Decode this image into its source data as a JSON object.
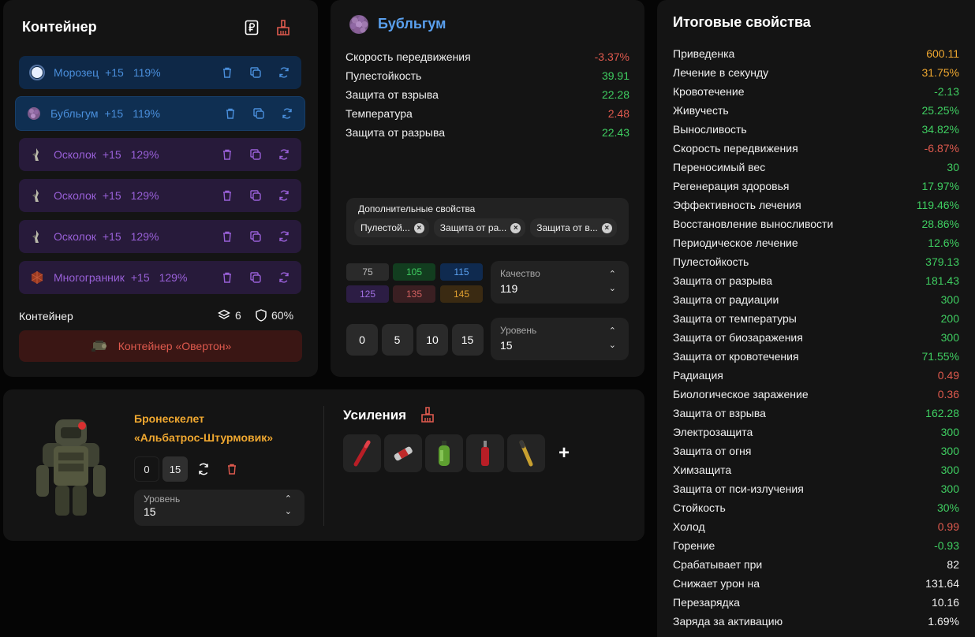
{
  "container": {
    "title": "Контейнер",
    "artifacts": [
      {
        "name": "Морозец",
        "level": "+15",
        "percent": "119%",
        "color": "blue",
        "icon": "snowflake-orb-icon"
      },
      {
        "name": "Бубльгум",
        "level": "+15",
        "percent": "119%",
        "color": "blue",
        "icon": "bubblegum-icon",
        "selected": true
      },
      {
        "name": "Осколок",
        "level": "+15",
        "percent": "129%",
        "color": "purple",
        "icon": "shard-icon"
      },
      {
        "name": "Осколок",
        "level": "+15",
        "percent": "129%",
        "color": "purple",
        "icon": "shard-icon"
      },
      {
        "name": "Осколок",
        "level": "+15",
        "percent": "129%",
        "color": "purple",
        "icon": "shard-icon"
      },
      {
        "name": "Многогранник",
        "level": "+15",
        "percent": "129%",
        "color": "purple",
        "icon": "polyhedron-icon"
      }
    ],
    "footer_label": "Контейнер",
    "slots": "6",
    "protection": "60%",
    "container_name": "Контейнер «Овертон»"
  },
  "artifact": {
    "name": "Бубльгум",
    "stats": [
      {
        "label": "Скорость передвижения",
        "value": "-3.37%",
        "tone": "neg"
      },
      {
        "label": "Пулестойкость",
        "value": "39.91",
        "tone": "pos"
      },
      {
        "label": "Защита от взрыва",
        "value": "22.28",
        "tone": "pos"
      },
      {
        "label": "Температура",
        "value": "2.48",
        "tone": "neg"
      },
      {
        "label": "Защита от разрыва",
        "value": "22.43",
        "tone": "pos"
      }
    ],
    "extra_title": "Дополнительные свойства",
    "extra_chips": [
      "Пулестой...",
      "Защита от ра...",
      "Защита от в..."
    ],
    "quality_buttons": [
      {
        "label": "75",
        "bg": "#2a2a2a",
        "fg": "#bdbdbd"
      },
      {
        "label": "105",
        "bg": "#123d1f",
        "fg": "#3fce61"
      },
      {
        "label": "115",
        "bg": "#0f2a4f",
        "fg": "#5aa0ee"
      },
      {
        "label": "125",
        "bg": "#2c1d44",
        "fg": "#a070e0"
      },
      {
        "label": "135",
        "bg": "#3a1f22",
        "fg": "#d06060"
      },
      {
        "label": "145",
        "bg": "#3a2a12",
        "fg": "#e0a030"
      }
    ],
    "quality_label": "Качество",
    "quality_value": "119",
    "level_buttons": [
      "0",
      "5",
      "10",
      "15"
    ],
    "level_label": "Уровень",
    "level_value": "15"
  },
  "armor": {
    "name_line1": "Бронескелет",
    "name_line2": "«Альбатрос-Штурмовик»",
    "level_buttons": [
      "0",
      "15"
    ],
    "level_label": "Уровень",
    "level_value": "15",
    "boosts_title": "Усиления",
    "boosts": [
      "red-stick-icon",
      "syringe-icon",
      "green-bottle-icon",
      "red-bottle-icon",
      "yellow-stick-icon"
    ],
    "add_label": "+"
  },
  "summary": {
    "title": "Итоговые свойства",
    "rows": [
      {
        "label": "Приведенка",
        "value": "600.11",
        "tone": "gold"
      },
      {
        "label": "Лечение в секунду",
        "value": "31.75%",
        "tone": "gold"
      },
      {
        "label": "Кровотечение",
        "value": "-2.13",
        "tone": "pos"
      },
      {
        "label": "Живучесть",
        "value": "25.25%",
        "tone": "pos"
      },
      {
        "label": "Выносливость",
        "value": "34.82%",
        "tone": "pos"
      },
      {
        "label": "Скорость передвижения",
        "value": "-6.87%",
        "tone": "neg"
      },
      {
        "label": "Переносимый вес",
        "value": "30",
        "tone": "pos"
      },
      {
        "label": "Регенерация здоровья",
        "value": "17.97%",
        "tone": "pos"
      },
      {
        "label": "Эффективность лечения",
        "value": "119.46%",
        "tone": "pos"
      },
      {
        "label": "Восстановление выносливости",
        "value": "28.86%",
        "tone": "pos"
      },
      {
        "label": "Периодическое лечение",
        "value": "12.6%",
        "tone": "pos"
      },
      {
        "label": "Пулестойкость",
        "value": "379.13",
        "tone": "pos"
      },
      {
        "label": "Защита от разрыва",
        "value": "181.43",
        "tone": "pos"
      },
      {
        "label": "Защита от радиации",
        "value": "300",
        "tone": "pos"
      },
      {
        "label": "Защита от температуры",
        "value": "200",
        "tone": "pos"
      },
      {
        "label": "Защита от биозаражения",
        "value": "300",
        "tone": "pos"
      },
      {
        "label": "Защита от кровотечения",
        "value": "71.55%",
        "tone": "pos"
      },
      {
        "label": "Радиация",
        "value": "0.49",
        "tone": "neg"
      },
      {
        "label": "Биологическое заражение",
        "value": "0.36",
        "tone": "neg"
      },
      {
        "label": "Защита от взрыва",
        "value": "162.28",
        "tone": "pos"
      },
      {
        "label": "Электрозащита",
        "value": "300",
        "tone": "pos"
      },
      {
        "label": "Защита от огня",
        "value": "300",
        "tone": "pos"
      },
      {
        "label": "Химзащита",
        "value": "300",
        "tone": "pos"
      },
      {
        "label": "Защита от пси-излучения",
        "value": "300",
        "tone": "pos"
      },
      {
        "label": "Стойкость",
        "value": "30%",
        "tone": "pos"
      },
      {
        "label": "Холод",
        "value": "0.99",
        "tone": "neg"
      },
      {
        "label": "Горение",
        "value": "-0.93",
        "tone": "pos"
      },
      {
        "label": "Срабатывает при",
        "value": "82",
        "tone": "white"
      },
      {
        "label": "Снижает урон на",
        "value": "131.64",
        "tone": "white"
      },
      {
        "label": "Перезарядка",
        "value": "10.16",
        "tone": "white"
      },
      {
        "label": "Заряда за активацию",
        "value": "1.69%",
        "tone": "white"
      }
    ]
  }
}
